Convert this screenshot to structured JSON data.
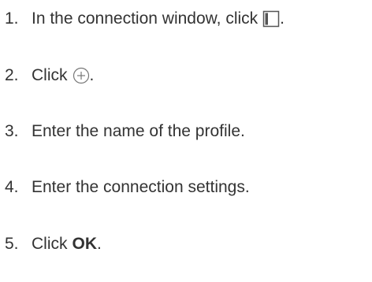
{
  "steps": [
    {
      "number": "1.",
      "text": "In the connection window, click",
      "icon": "sidebar-panel-icon",
      "suffix": "."
    },
    {
      "number": "2.",
      "text": "Click",
      "icon": "add-circle-icon",
      "suffix": "."
    },
    {
      "number": "3.",
      "text": "Enter the name of the profile."
    },
    {
      "number": "4.",
      "text": "Enter the connection settings."
    },
    {
      "number": "5.",
      "text": "Click",
      "bold": "OK",
      "suffix": "."
    }
  ],
  "colors": {
    "text": "#333333",
    "icon_stroke": "#555555"
  }
}
